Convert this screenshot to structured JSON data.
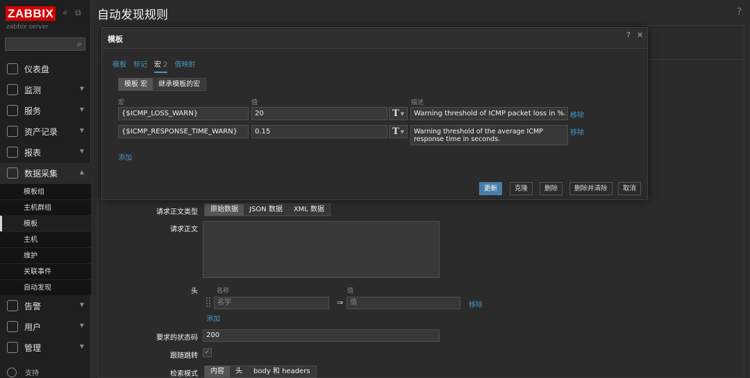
{
  "sidebar": {
    "logo": "ZABBIX",
    "collapse_icon": "«",
    "kiosk_icon": "⧉",
    "server_name": "zabbix server",
    "menu": [
      {
        "label": "仪表盘",
        "icon": "dashboard-icon",
        "has_chevron": false
      },
      {
        "label": "监测",
        "icon": "monitoring-icon",
        "has_chevron": true
      },
      {
        "label": "服务",
        "icon": "services-icon",
        "has_chevron": true
      },
      {
        "label": "资产记录",
        "icon": "inventory-icon",
        "has_chevron": true
      },
      {
        "label": "报表",
        "icon": "reports-icon",
        "has_chevron": true
      },
      {
        "label": "数据采集",
        "icon": "data-collection-icon",
        "has_chevron": true,
        "open": true
      }
    ],
    "submenu": [
      "模板组",
      "主机群组",
      "模板",
      "主机",
      "维护",
      "关联事件",
      "自动发现"
    ],
    "submenu_active": "模板",
    "menu_bottom": [
      {
        "label": "告警",
        "icon": "alerts-icon"
      },
      {
        "label": "用户",
        "icon": "users-icon"
      },
      {
        "label": "管理",
        "icon": "administration-icon"
      }
    ],
    "support": "支持"
  },
  "header": {
    "title": "自动发现规则",
    "help": "?"
  },
  "form": {
    "body_type_label": "请求正文类型",
    "body_type_options": [
      "原始数据",
      "JSON 数据",
      "XML 数据"
    ],
    "body_type_selected": "原始数据",
    "body_label": "请求正文",
    "headers_label": "头",
    "headers_col_name": "名称",
    "headers_col_value": "值",
    "header_name_placeholder": "名字",
    "header_value_placeholder": "值",
    "header_arrow": "⇒",
    "header_remove": "移除",
    "header_add": "添加",
    "status_codes_label": "要求的状态码",
    "status_codes_value": "200",
    "follow_redirects_label": "跟随跳转",
    "follow_redirects_checked": "✓",
    "retrieve_mode_label": "检索模式",
    "retrieve_mode_options": [
      "内容",
      "头",
      "body 和 headers"
    ],
    "retrieve_mode_selected": "内容"
  },
  "modal": {
    "title": "模板",
    "help": "?",
    "close": "✕",
    "tabs": [
      {
        "label": "模板"
      },
      {
        "label": "标记"
      },
      {
        "label": "宏",
        "count": "2",
        "active": true
      },
      {
        "label": "值映射"
      }
    ],
    "macro_views": [
      "模板 宏",
      "继承模板的宏"
    ],
    "macro_view_selected": "模板 宏",
    "col_macro": "宏",
    "col_value": "值",
    "col_description": "描述",
    "macros": [
      {
        "macro": "{$ICMP_LOSS_WARN}",
        "value": "20",
        "description": "Warning threshold of ICMP packet loss in %.",
        "remove": "移除"
      },
      {
        "macro": "{$ICMP_RESPONSE_TIME_WARN}",
        "value": "0.15",
        "description": "Warning threshold of the average ICMP response time in seconds.",
        "remove": "移除"
      }
    ],
    "add": "添加",
    "type_glyph": "T",
    "buttons": {
      "update": "更新",
      "clone": "克隆",
      "delete": "删除",
      "delete_clear": "删除并清除",
      "cancel": "取消"
    }
  },
  "colors": {
    "accent_link": "#4796c4",
    "primary_button": "#4a7ea8",
    "logo_red": "#d40000",
    "background": "#2b2b2b"
  }
}
